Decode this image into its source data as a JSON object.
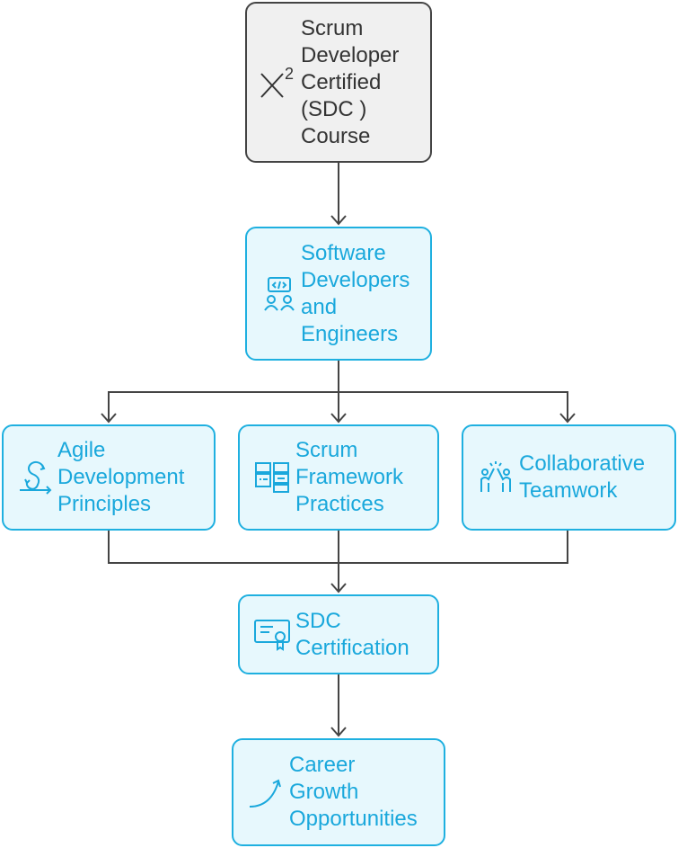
{
  "colors": {
    "accent": "#1fb0e0",
    "accent_fill": "#e7f8fd",
    "root_fill": "#f0f0f0",
    "connector": "#444444"
  },
  "nodes": {
    "course": {
      "label": "Scrum\nDeveloper\nCertified\n(SDC )\nCourse",
      "icon": "x-squared-icon"
    },
    "developers": {
      "label": "Software\nDevelopers\nand\nEngineers",
      "icon": "developers-code-icon"
    },
    "agile": {
      "label": "Agile\nDevelopment\nPrinciples",
      "icon": "agile-loop-icon"
    },
    "scrum": {
      "label": "Scrum\nFramework\nPractices",
      "icon": "framework-panels-icon"
    },
    "teamwork": {
      "label": "Collaborative\nTeamwork",
      "icon": "team-high-five-icon"
    },
    "certification": {
      "label": "SDC\nCertification",
      "icon": "certificate-icon"
    },
    "career": {
      "label": "Career\nGrowth\nOpportunities",
      "icon": "growth-arrow-icon"
    }
  }
}
